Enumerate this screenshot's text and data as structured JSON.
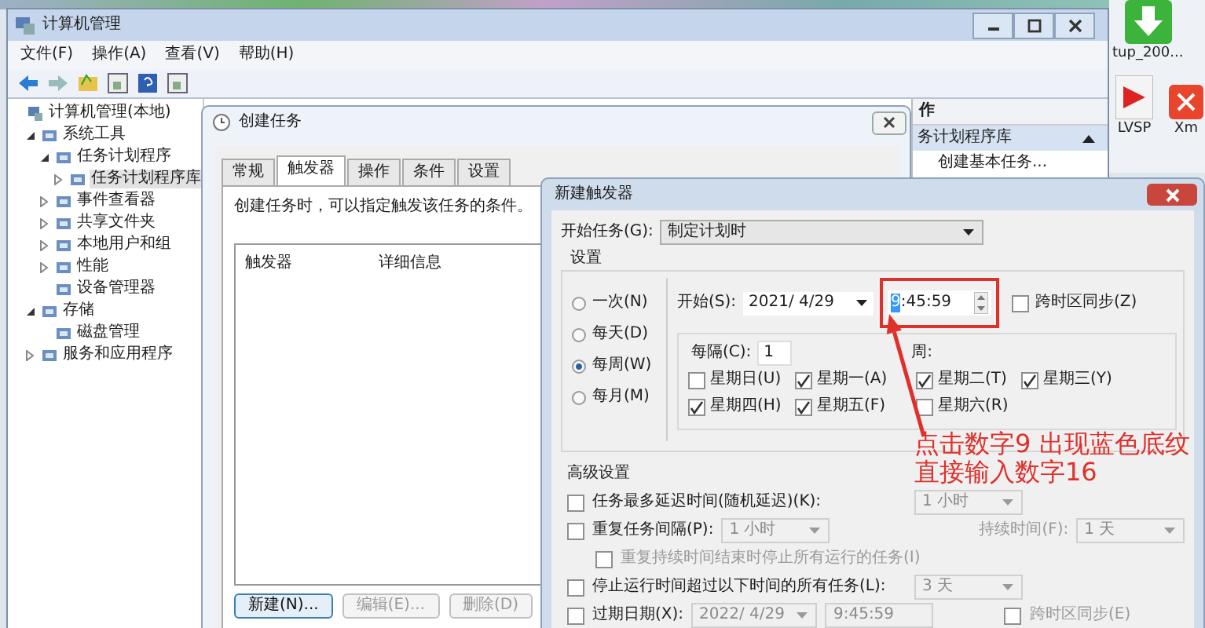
{
  "desktop": {
    "icons": [
      {
        "label": "tup_200..."
      },
      {
        "label": "LVSP"
      },
      {
        "label": "Xm"
      }
    ]
  },
  "main_window": {
    "title": "计算机管理",
    "menu": [
      "文件(F)",
      "操作(A)",
      "查看(V)",
      "帮助(H)"
    ],
    "tree": [
      {
        "label": "计算机管理(本地)",
        "selected": false,
        "children": [
          {
            "label": "系统工具",
            "expanded": true,
            "selected": false,
            "children": [
              {
                "label": "任务计划程序",
                "expanded": true,
                "selected": false,
                "children": [
                  {
                    "label": "任务计划程序库",
                    "expanded": false,
                    "selected": true
                  }
                ]
              },
              {
                "label": "事件查看器",
                "expanded": false,
                "selected": false
              },
              {
                "label": "共享文件夹",
                "expanded": false,
                "selected": false
              },
              {
                "label": "本地用户和组",
                "expanded": false,
                "selected": false
              },
              {
                "label": "性能",
                "expanded": false,
                "selected": false
              },
              {
                "label": "设备管理器",
                "selected": false
              }
            ]
          },
          {
            "label": "存储",
            "expanded": true,
            "selected": false,
            "children": [
              {
                "label": "磁盘管理",
                "selected": false
              }
            ]
          },
          {
            "label": "服务和应用程序",
            "expanded": false,
            "selected": false
          }
        ]
      }
    ],
    "action_pane": {
      "header": "作",
      "section": "务计划程序库",
      "items": [
        "创建基本任务..."
      ]
    }
  },
  "create_task": {
    "title": "创建任务",
    "tabs": [
      {
        "label": "常规",
        "selected": false
      },
      {
        "label": "触发器",
        "selected": true
      },
      {
        "label": "操作",
        "selected": false
      },
      {
        "label": "条件",
        "selected": false
      },
      {
        "label": "设置",
        "selected": false
      }
    ],
    "description": "创建任务时，可以指定触发该任务的条件。",
    "columns": [
      "触发器",
      "详细信息"
    ],
    "buttons": [
      {
        "label": "新建(N)...",
        "disabled": false
      },
      {
        "label": "编辑(E)...",
        "disabled": true
      },
      {
        "label": "删除(D)",
        "disabled": true
      }
    ]
  },
  "new_trigger": {
    "title": "新建触发器",
    "begin_label": "开始任务(G):",
    "begin_value": "制定计划时",
    "settings_title": "设置",
    "schedules": [
      {
        "label": "一次(N)",
        "selected": false
      },
      {
        "label": "每天(D)",
        "selected": false
      },
      {
        "label": "每周(W)",
        "selected": true
      },
      {
        "label": "每月(M)",
        "selected": false
      }
    ],
    "start_label": "开始(S):",
    "start_date": "2021/  4/29",
    "start_time": {
      "hour": "9",
      "rest": ":45:59",
      "hour_selected": true
    },
    "sync_label": "跨时区同步(Z)",
    "sync_checked": false,
    "every_label": "每隔(C):",
    "every_value": "1",
    "unit": "周:",
    "weekdays": [
      {
        "label": "星期日(U)",
        "checked": false
      },
      {
        "label": "星期一(A)",
        "checked": true
      },
      {
        "label": "星期二(T)",
        "checked": true
      },
      {
        "label": "星期三(Y)",
        "checked": true
      },
      {
        "label": "星期四(H)",
        "checked": true
      },
      {
        "label": "星期五(F)",
        "checked": true
      },
      {
        "label": "星期六(R)",
        "checked": false
      }
    ],
    "advanced_title": "高级设置",
    "advanced": [
      {
        "kind": "select",
        "label": "任务最多延迟时间(随机延迟)(K):",
        "checked": false,
        "disabled": true,
        "value": "1 小时"
      },
      {
        "kind": "repeat",
        "label": "重复任务间隔(P):",
        "checked": false,
        "disabled": true,
        "value": "1 小时",
        "duration_label": "持续时间(F):",
        "duration_value": "1 天"
      },
      {
        "kind": "sub",
        "label": "重复持续时间结束时停止所有运行的任务(I)",
        "checked": false,
        "disabled": true
      },
      {
        "kind": "select",
        "label": "停止运行时间超过以下时间的所有任务(L):",
        "checked": false,
        "disabled": true,
        "value": "3 天"
      },
      {
        "kind": "expire",
        "label": "过期日期(X):",
        "checked": false,
        "disabled": true,
        "date": "2022/  4/29",
        "time": "9:45:59",
        "sync_label": "跨时区同步(E)",
        "sync_checked": false
      }
    ]
  },
  "annotation": {
    "lines": [
      "点击数字9 出现蓝色底纹",
      "直接输入数字16"
    ]
  }
}
